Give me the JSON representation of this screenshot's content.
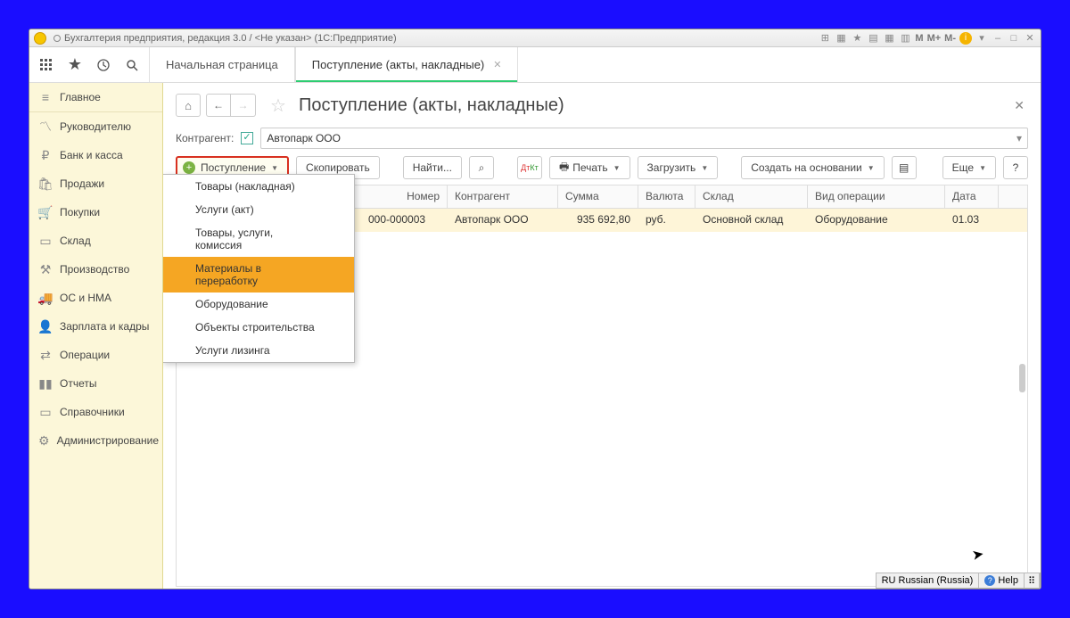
{
  "window": {
    "title": "Бухгалтерия предприятия, редакция 3.0 / <Не указан>  (1С:Предприятие)",
    "m1": "M",
    "m2": "M+",
    "m3": "M-"
  },
  "tabs": {
    "home": "Начальная страница",
    "active": "Поступление (акты, накладные)"
  },
  "sidebar": [
    {
      "icon": "menu",
      "label": "Главное"
    },
    {
      "icon": "chart",
      "label": "Руководителю"
    },
    {
      "icon": "ruble",
      "label": "Банк и касса"
    },
    {
      "icon": "bag",
      "label": "Продажи"
    },
    {
      "icon": "cart",
      "label": "Покупки"
    },
    {
      "icon": "box",
      "label": "Склад"
    },
    {
      "icon": "factory",
      "label": "Производство"
    },
    {
      "icon": "truck",
      "label": "ОС и НМА"
    },
    {
      "icon": "person",
      "label": "Зарплата и кадры"
    },
    {
      "icon": "ops",
      "label": "Операции"
    },
    {
      "icon": "bars",
      "label": "Отчеты"
    },
    {
      "icon": "book",
      "label": "Справочники"
    },
    {
      "icon": "gear",
      "label": "Администрирование"
    }
  ],
  "page": {
    "title": "Поступление (акты, накладные)",
    "filter_label": "Контрагент:",
    "filter_value": "Автопарк ООО"
  },
  "toolbar": {
    "postup": "Поступление",
    "copy": "Скопировать",
    "find": "Найти...",
    "print": "Печать",
    "load": "Загрузить",
    "create_based": "Создать на основании",
    "more": "Еще",
    "help": "?"
  },
  "dropdown": [
    "Товары (накладная)",
    "Услуги (акт)",
    "Товары, услуги, комиссия",
    "Материалы в переработку",
    "Оборудование",
    "Объекты строительства",
    "Услуги лизинга"
  ],
  "dropdown_hover_index": 3,
  "table": {
    "headers": {
      "num": "Номер",
      "cont": "Контрагент",
      "sum": "Сумма",
      "cur": "Валюта",
      "wh": "Склад",
      "type": "Вид операции",
      "dt": "Дата"
    },
    "row": {
      "num": "000-000003",
      "cont": "Автопарк ООО",
      "sum": "935 692,80",
      "cur": "руб.",
      "wh": "Основной склад",
      "type": "Оборудование",
      "dt": "01.03"
    }
  },
  "status": {
    "lang": "RU Russian (Russia)",
    "help": "Help"
  }
}
